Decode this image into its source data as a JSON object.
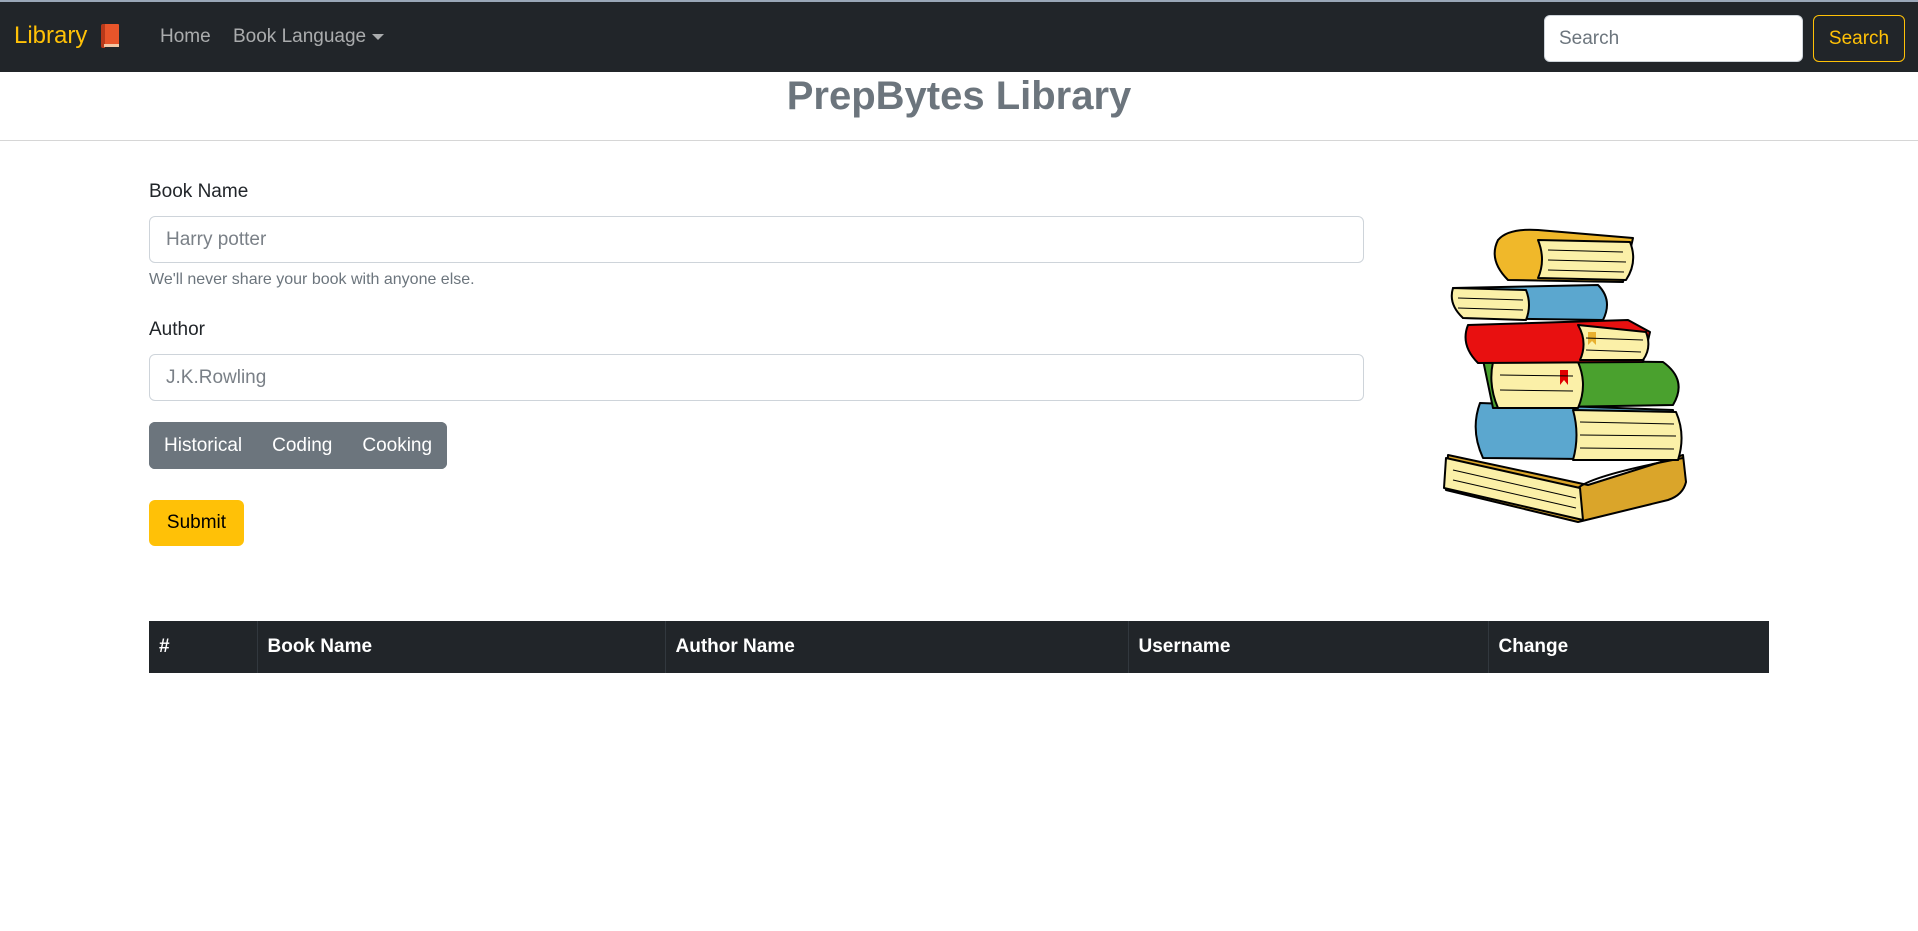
{
  "navbar": {
    "brand": "Library",
    "brand_icon": "book-icon",
    "links": [
      "Home",
      "Book Language"
    ],
    "search_placeholder": "Search",
    "search_button": "Search",
    "accent_color": "#ffc107"
  },
  "header": {
    "title": "PrepBytes Library"
  },
  "form": {
    "book_name_label": "Book Name",
    "book_name_placeholder": "Harry potter",
    "book_help": "We'll never share your book with anyone else.",
    "author_label": "Author",
    "author_placeholder": "J.K.Rowling",
    "categories": [
      "Historical",
      "Coding",
      "Cooking"
    ],
    "submit_label": "Submit"
  },
  "illustration": "stack-of-books-icon",
  "table": {
    "headers": [
      "#",
      "Book Name",
      "Author Name",
      "Username",
      "Change"
    ],
    "rows": []
  }
}
